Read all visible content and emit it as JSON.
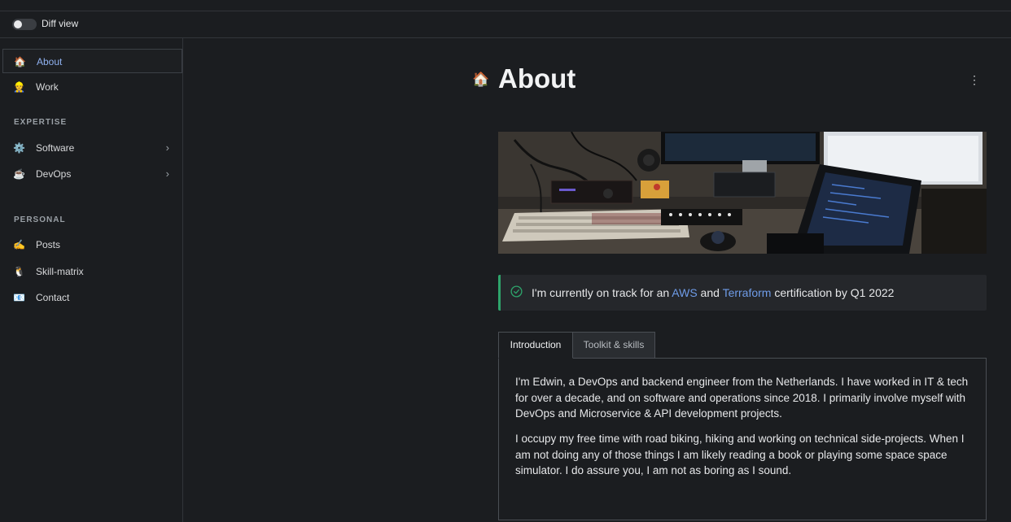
{
  "diff": {
    "label": "Diff view",
    "enabled": false
  },
  "sidebar": {
    "items": [
      {
        "label": "About",
        "icon": "🏠",
        "icon_name": "house-icon",
        "active": true
      },
      {
        "label": "Work",
        "icon": "👷",
        "icon_name": "construction-worker-icon"
      }
    ],
    "sections": [
      {
        "title": "EXPERTISE",
        "items": [
          {
            "label": "Software",
            "icon": "⚙️",
            "icon_name": "gear-icon",
            "expandable": true
          },
          {
            "label": "DevOps",
            "icon": "☕",
            "icon_name": "coffee-icon",
            "expandable": true
          }
        ]
      },
      {
        "title": "PERSONAL",
        "items": [
          {
            "label": "Posts",
            "icon": "✍️",
            "icon_name": "writing-hand-icon"
          },
          {
            "label": "Skill-matrix",
            "icon": "🐧",
            "icon_name": "penguin-icon"
          },
          {
            "label": "Contact",
            "icon": "📧",
            "icon_name": "email-icon"
          }
        ]
      }
    ],
    "chevron": "›"
  },
  "page": {
    "icon": "🏠",
    "title": "About",
    "menu_icon": "⋮"
  },
  "callout": {
    "part1": "I'm currently on track for an ",
    "link1": "AWS",
    "part2": " and ",
    "link2": "Terraform",
    "part3": " certification by Q1 2022",
    "accent_color": "#2ea46b"
  },
  "tabs": [
    {
      "label": "Introduction",
      "active": true
    },
    {
      "label": "Toolkit & skills",
      "active": false
    }
  ],
  "intro": {
    "paragraph1": "I'm Edwin, a DevOps and backend engineer from the Netherlands. I have worked in IT & tech for over a decade, and on software and operations since 2018. I primarily involve myself with DevOps and Microservice & API development projects.",
    "paragraph2": "I occupy my free time with road biking, hiking and working on technical side-projects. When I am not doing any of those things I am likely reading a book or playing some space space simulator. I do assure you, I am not as boring as I sound."
  },
  "colors": {
    "background": "#1b1d20",
    "link": "#6f9ce8",
    "active_nav": "#8fb1f0",
    "success": "#2ea46b"
  }
}
